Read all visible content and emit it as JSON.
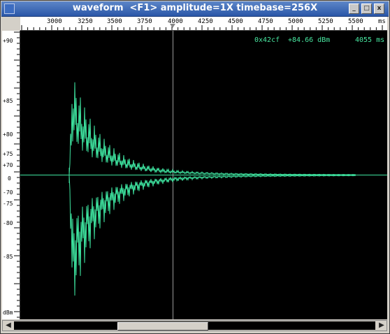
{
  "window": {
    "title": "waveform  <F1> amplitude=1X timebase=256X",
    "buttons": {
      "minimize": "_",
      "maximize": "□",
      "close": "x"
    }
  },
  "hruler": {
    "ticks": [
      "3000",
      "3250",
      "3500",
      "3750",
      "4000",
      "4250",
      "4500",
      "4750",
      "5000",
      "5250",
      "5500"
    ],
    "unit": "ms"
  },
  "vruler": {
    "ticks": [
      "+90",
      "+85",
      "+80",
      "+75",
      "+70",
      "0",
      "-70",
      "-75",
      "-80",
      "-85"
    ],
    "unit": "dBm"
  },
  "readout": {
    "address": "0x42cf",
    "level": "+84.66 dBm",
    "time": "4055 ms"
  },
  "trace_color": "#3ee4a0",
  "background_color": "#000000"
}
